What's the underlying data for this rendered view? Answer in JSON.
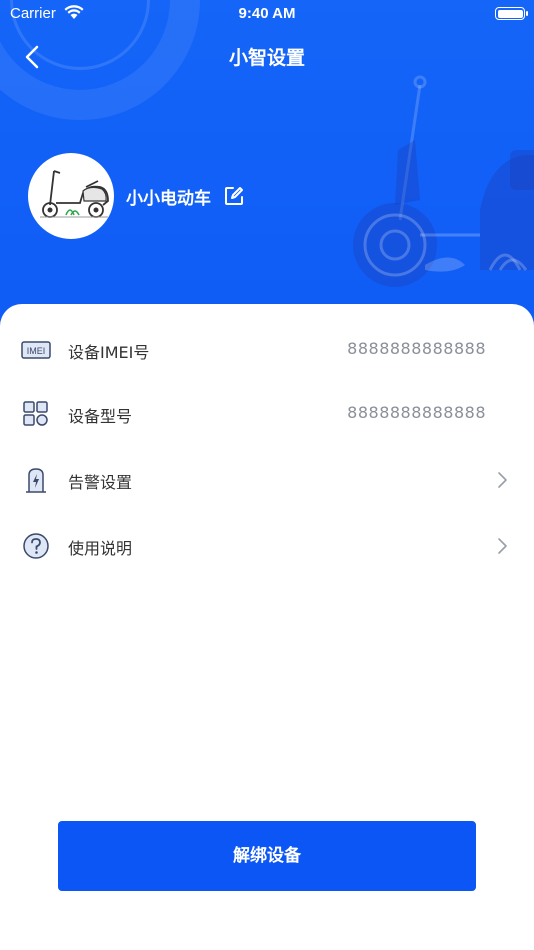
{
  "status_bar": {
    "carrier": "Carrier",
    "time": "9:40 AM"
  },
  "nav": {
    "title": "小智设置"
  },
  "device": {
    "name": "小小电动车"
  },
  "rows": [
    {
      "label": "设备IMEI号",
      "value": "8888888888888",
      "icon": "imei-icon"
    },
    {
      "label": "设备型号",
      "value": "8888888888888",
      "icon": "grid-icon"
    },
    {
      "label": "告警设置",
      "value": "",
      "icon": "alarm-battery-icon"
    },
    {
      "label": "使用说明",
      "value": "",
      "icon": "help-icon"
    }
  ],
  "imei_icon_text": "IMEI",
  "actions": {
    "unbind": "解绑设备"
  },
  "colors": {
    "primary": "#0f5cf6",
    "label": "#333333",
    "value": "#8a8f99"
  }
}
